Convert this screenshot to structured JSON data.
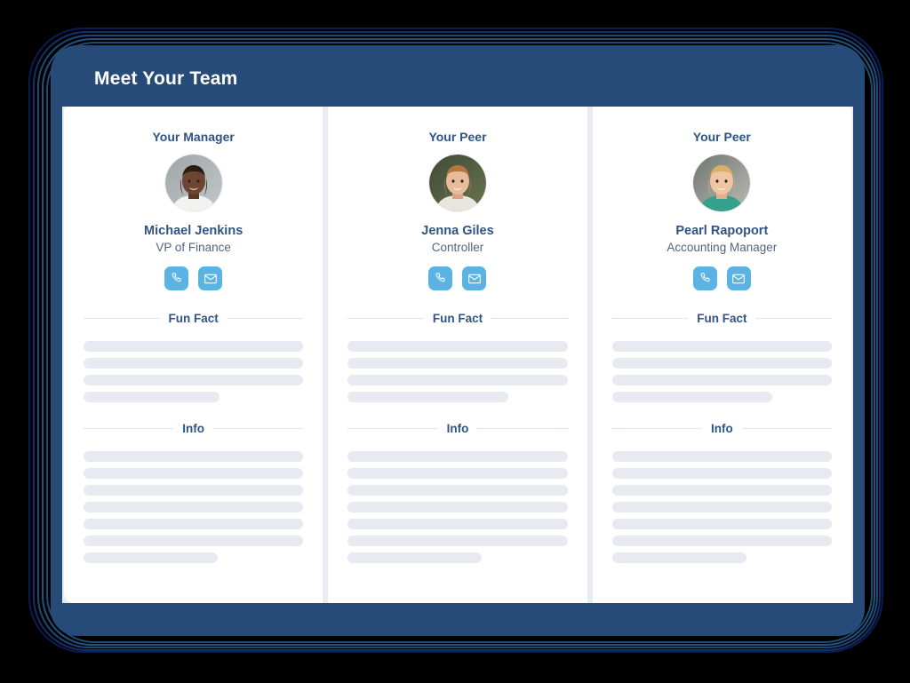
{
  "window": {
    "title": "Meet Your Team",
    "header_color": "#274b78",
    "body_color": "#e9ecf2",
    "frame_color": "#274b78",
    "accent_color": "#2f5486",
    "action_color": "#5bb3e4",
    "skeleton_color": "#e7eaf0"
  },
  "sections": {
    "fun_fact_label": "Fun Fact",
    "info_label": "Info"
  },
  "actions": {
    "phone_label": "Call",
    "email_label": "Email",
    "phone_icon": "phone-icon",
    "email_icon": "envelope-icon"
  },
  "cards": [
    {
      "role": "Your Manager",
      "name": "Michael Jenkins",
      "title": "VP of Finance",
      "avatar": "photo-michael-jenkins",
      "fun_fact_bars": [
        100,
        100,
        100,
        62
      ],
      "info_bars": [
        100,
        100,
        100,
        100,
        100,
        100,
        61
      ]
    },
    {
      "role": "Your Peer",
      "name": "Jenna Giles",
      "title": "Controller",
      "avatar": "photo-jenna-giles",
      "fun_fact_bars": [
        100,
        100,
        100,
        73
      ],
      "info_bars": [
        100,
        100,
        100,
        100,
        100,
        100,
        61
      ]
    },
    {
      "role": "Your Peer",
      "name": "Pearl Rapoport",
      "title": "Accounting Manager",
      "avatar": "photo-pearl-rapoport",
      "fun_fact_bars": [
        100,
        100,
        100,
        73
      ],
      "info_bars": [
        100,
        100,
        100,
        100,
        100,
        100,
        61
      ]
    }
  ]
}
